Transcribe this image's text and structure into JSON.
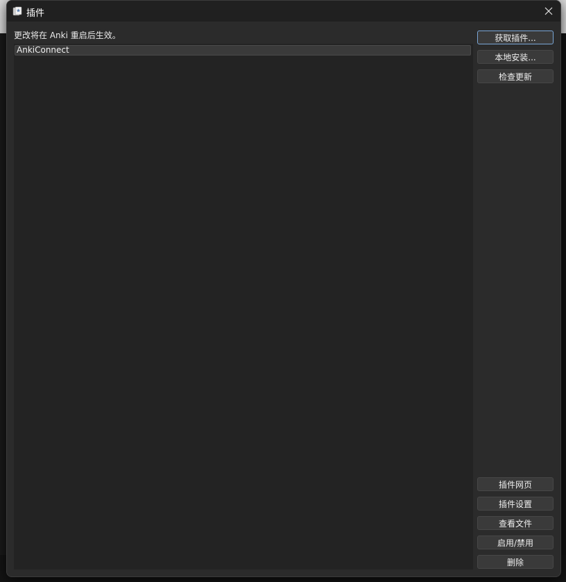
{
  "window": {
    "title": "插件"
  },
  "notice": "更改将在 Anki 重启后生效。",
  "addons": [
    {
      "name": "AnkiConnect"
    }
  ],
  "buttons": {
    "get_addons": "获取插件...",
    "install_local": "本地安装...",
    "check_updates": "检查更新",
    "addon_page": "插件网页",
    "addon_config": "插件设置",
    "view_files": "查看文件",
    "toggle_enabled": "启用/禁用",
    "delete": "删除"
  },
  "colors": {
    "dialog_bg": "#2b2b2b",
    "titlebar_bg": "#202020",
    "list_bg": "#232323",
    "button_bg": "#3a3a3a",
    "focus_border": "#7aa7d8"
  },
  "icons": {
    "app": "anki-icon",
    "close": "close-icon"
  }
}
